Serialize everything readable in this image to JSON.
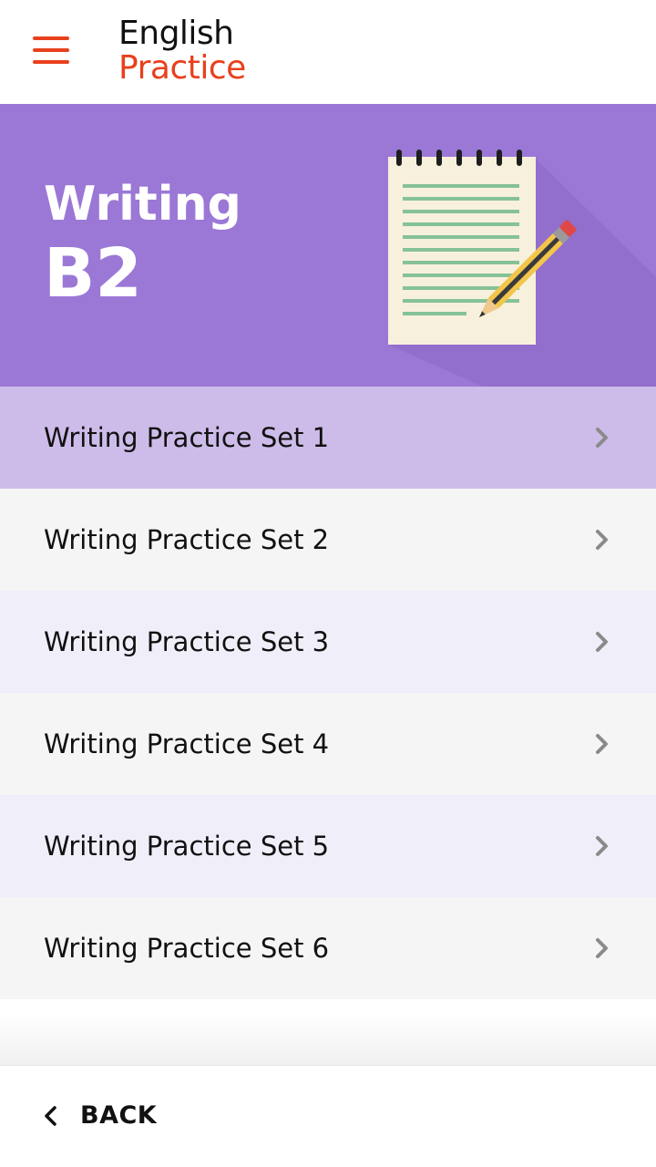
{
  "header": {
    "menu_icon": "hamburger-menu-icon",
    "logo_line1": "English",
    "logo_line2": "Practice",
    "accent_color": "#e8401c"
  },
  "hero": {
    "title": "Writing",
    "level": "B2",
    "background_color": "#9b78d6",
    "illustration": "notepad-with-pencil"
  },
  "sets": [
    {
      "label": "Writing Practice Set 1",
      "highlighted": true
    },
    {
      "label": "Writing Practice Set 2"
    },
    {
      "label": "Writing Practice Set 3"
    },
    {
      "label": "Writing Practice Set 4"
    },
    {
      "label": "Writing Practice Set 5"
    },
    {
      "label": "Writing Practice Set 6"
    }
  ],
  "row_colors": {
    "highlighted": "#cdbce9",
    "even": "#f5f5f5",
    "odd": "#f0eff9"
  },
  "footer": {
    "back_label": "BACK",
    "back_icon": "chevron-left-icon"
  }
}
